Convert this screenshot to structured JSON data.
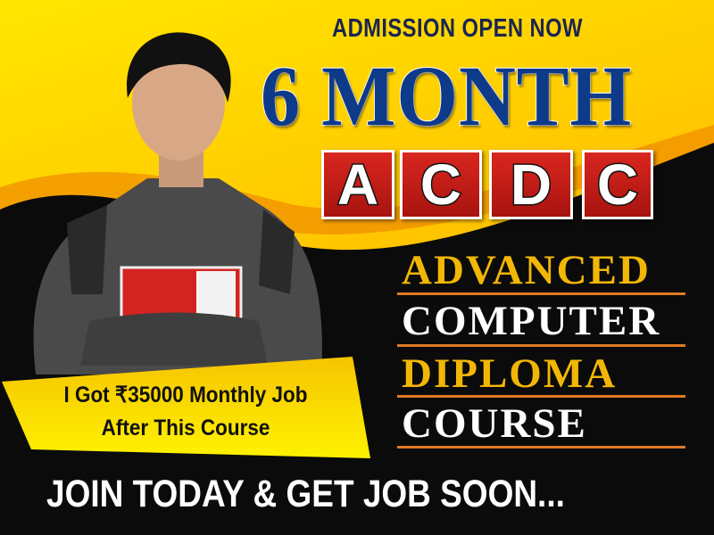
{
  "header": {
    "admission": "ADMISSION OPEN NOW",
    "duration": "6 MONTH",
    "acronym_letters": [
      "A",
      "C",
      "D",
      "C"
    ]
  },
  "course_name": {
    "lines": [
      "ADVANCED",
      "COMPUTER",
      "DIPLOMA",
      "COURSE"
    ],
    "colors": [
      "#f2b705",
      "#ffffff",
      "#f2b705",
      "#ffffff"
    ]
  },
  "testimonial": {
    "line1": "I Got ₹35000 Monthly Job",
    "line2": "After This Course"
  },
  "footer": {
    "cta": "JOIN TODAY & GET JOB SOON..."
  },
  "colors": {
    "navy": "#0e3a8a",
    "red": "#c81d17",
    "yellow": "#ffd200",
    "orange_rule": "#e07a22",
    "background_dark": "#0b0b0b"
  }
}
